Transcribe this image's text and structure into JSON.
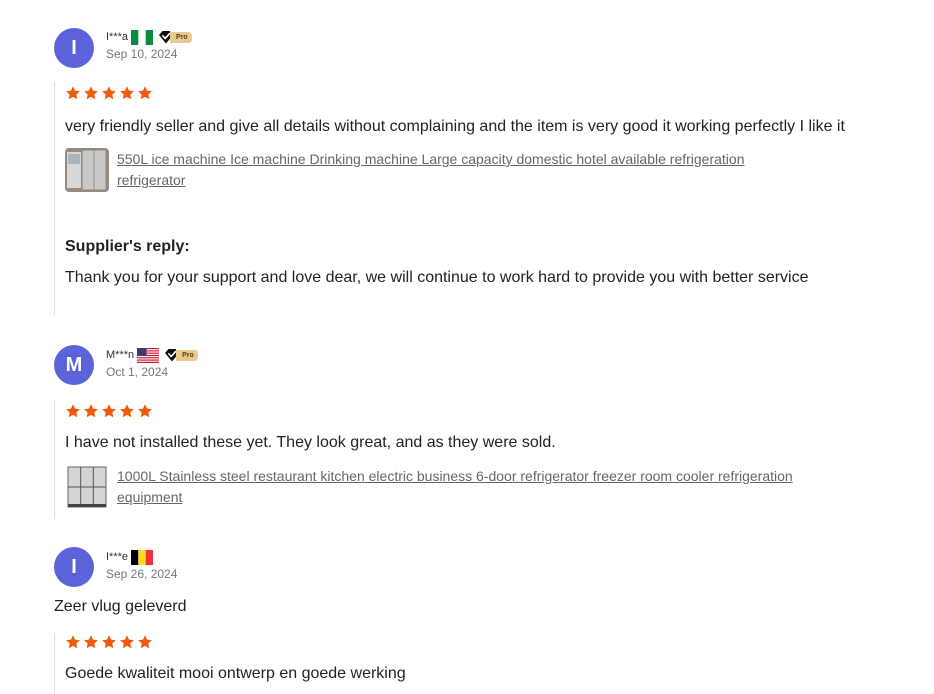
{
  "reviews": [
    {
      "avatar_letter": "I",
      "name": "I***a",
      "country_flag": "nigeria-flag",
      "pro_badge": "Pro",
      "date": "Sep 10, 2024",
      "rating": 5,
      "text": "very friendly seller and give all details without complaining and the item is very good it working perfectly I like it",
      "product": "550L ice machine Ice machine Drinking machine Large capacity domestic hotel available refrigeration refrigerator",
      "reply_title": "Supplier's reply:",
      "reply_text": "Thank you for your support and love dear, we will continue to work hard to provide you with better service"
    },
    {
      "avatar_letter": "M",
      "name": "M***n",
      "country_flag": "usa-flag",
      "pro_badge": "Pro",
      "date": "Oct 1, 2024",
      "rating": 5,
      "text": "I have not installed these yet. They look great, and as they were sold.",
      "product": "1000L Stainless steel restaurant kitchen electric business 6-door refrigerator freezer room cooler refrigeration equipment"
    },
    {
      "avatar_letter": "I",
      "name": "I***e",
      "country_flag": "belgium-flag",
      "date": "Sep 26, 2024",
      "pre_text": "Zeer vlug geleverd",
      "rating": 5,
      "text": "Goede kwaliteit mooi ontwerp en goede werking"
    }
  ],
  "colors": {
    "avatar": "#5a63d8",
    "star": "#f25a0b",
    "pro_badge": "#e9c98f",
    "link": "#666666"
  }
}
